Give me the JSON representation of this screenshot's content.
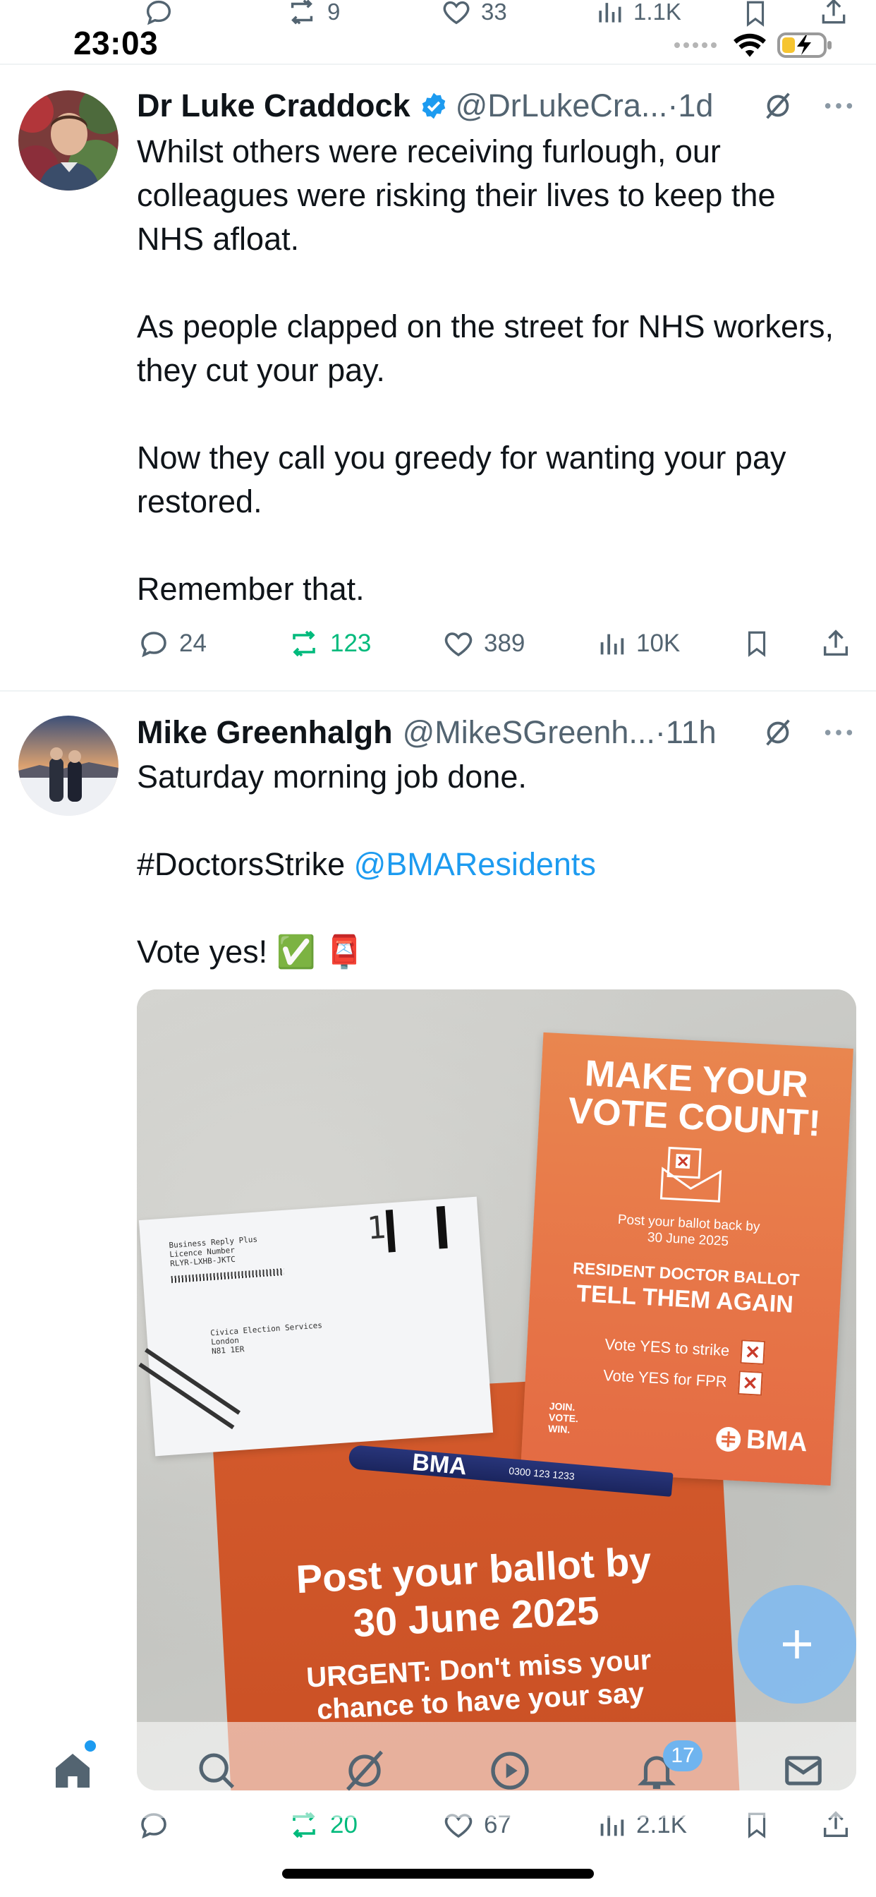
{
  "status_bar": {
    "time": "23:03"
  },
  "top_actions": {
    "replies": "",
    "reposts": "9",
    "likes": "33",
    "views": "1.1K"
  },
  "tweets": [
    {
      "name": "Dr Luke Craddock",
      "handle": "@DrLukeCra...",
      "sep": " · ",
      "time": "1d",
      "text": "Whilst others were receiving furlough, our colleagues were risking their lives to keep the NHS afloat.\n\nAs people clapped on the street for NHS workers, they cut your pay.\n\nNow they call you greedy for wanting your pay restored.\n\nRemember that.",
      "replies": "24",
      "reposts": "123",
      "likes": "389",
      "views": "10K"
    },
    {
      "name": "Mike Greenhalgh",
      "handle": "@MikeSGreenh...",
      "sep": " · ",
      "time": "11h",
      "line1": "Saturday morning job done.",
      "hashtag": "#DoctorsStrike",
      "mention": "@BMAResidents",
      "line3": "Vote yes! ✅ 📮",
      "replies": "",
      "reposts": "20",
      "likes": "67",
      "views": "2.1K"
    }
  ],
  "photo": {
    "envelope": {
      "reply_block": "Business Reply Plus\nLicence Number\nRLYR-LXHB-JKTC",
      "address": "Civica Election Services\nLondon\nN81 1ER",
      "mark": "1"
    },
    "leaflet": {
      "title": "MAKE YOUR\nVOTE COUNT!",
      "post_by": "Post your ballot back by\n30 June 2025",
      "ballot": "RESIDENT DOCTOR BALLOT",
      "tell": "TELL THEM AGAIN",
      "vote1": "Vote YES to strike",
      "vote2": "Vote YES for FPR",
      "join": "JOIN.\nVOTE.\nWIN.",
      "logo": "BMA"
    },
    "pen": {
      "brand": "BMA",
      "phone": "0300 123 1233"
    },
    "orange": {
      "title": "Post your ballot by\n30 June 2025",
      "urgent": "URGENT: Don't miss your\nchance to have your say"
    }
  },
  "tabbar": {
    "notifications_badge": "17"
  },
  "colors": {
    "accent": "#1d9bf0",
    "repost_green": "#00ba7c",
    "muted": "#536471"
  }
}
